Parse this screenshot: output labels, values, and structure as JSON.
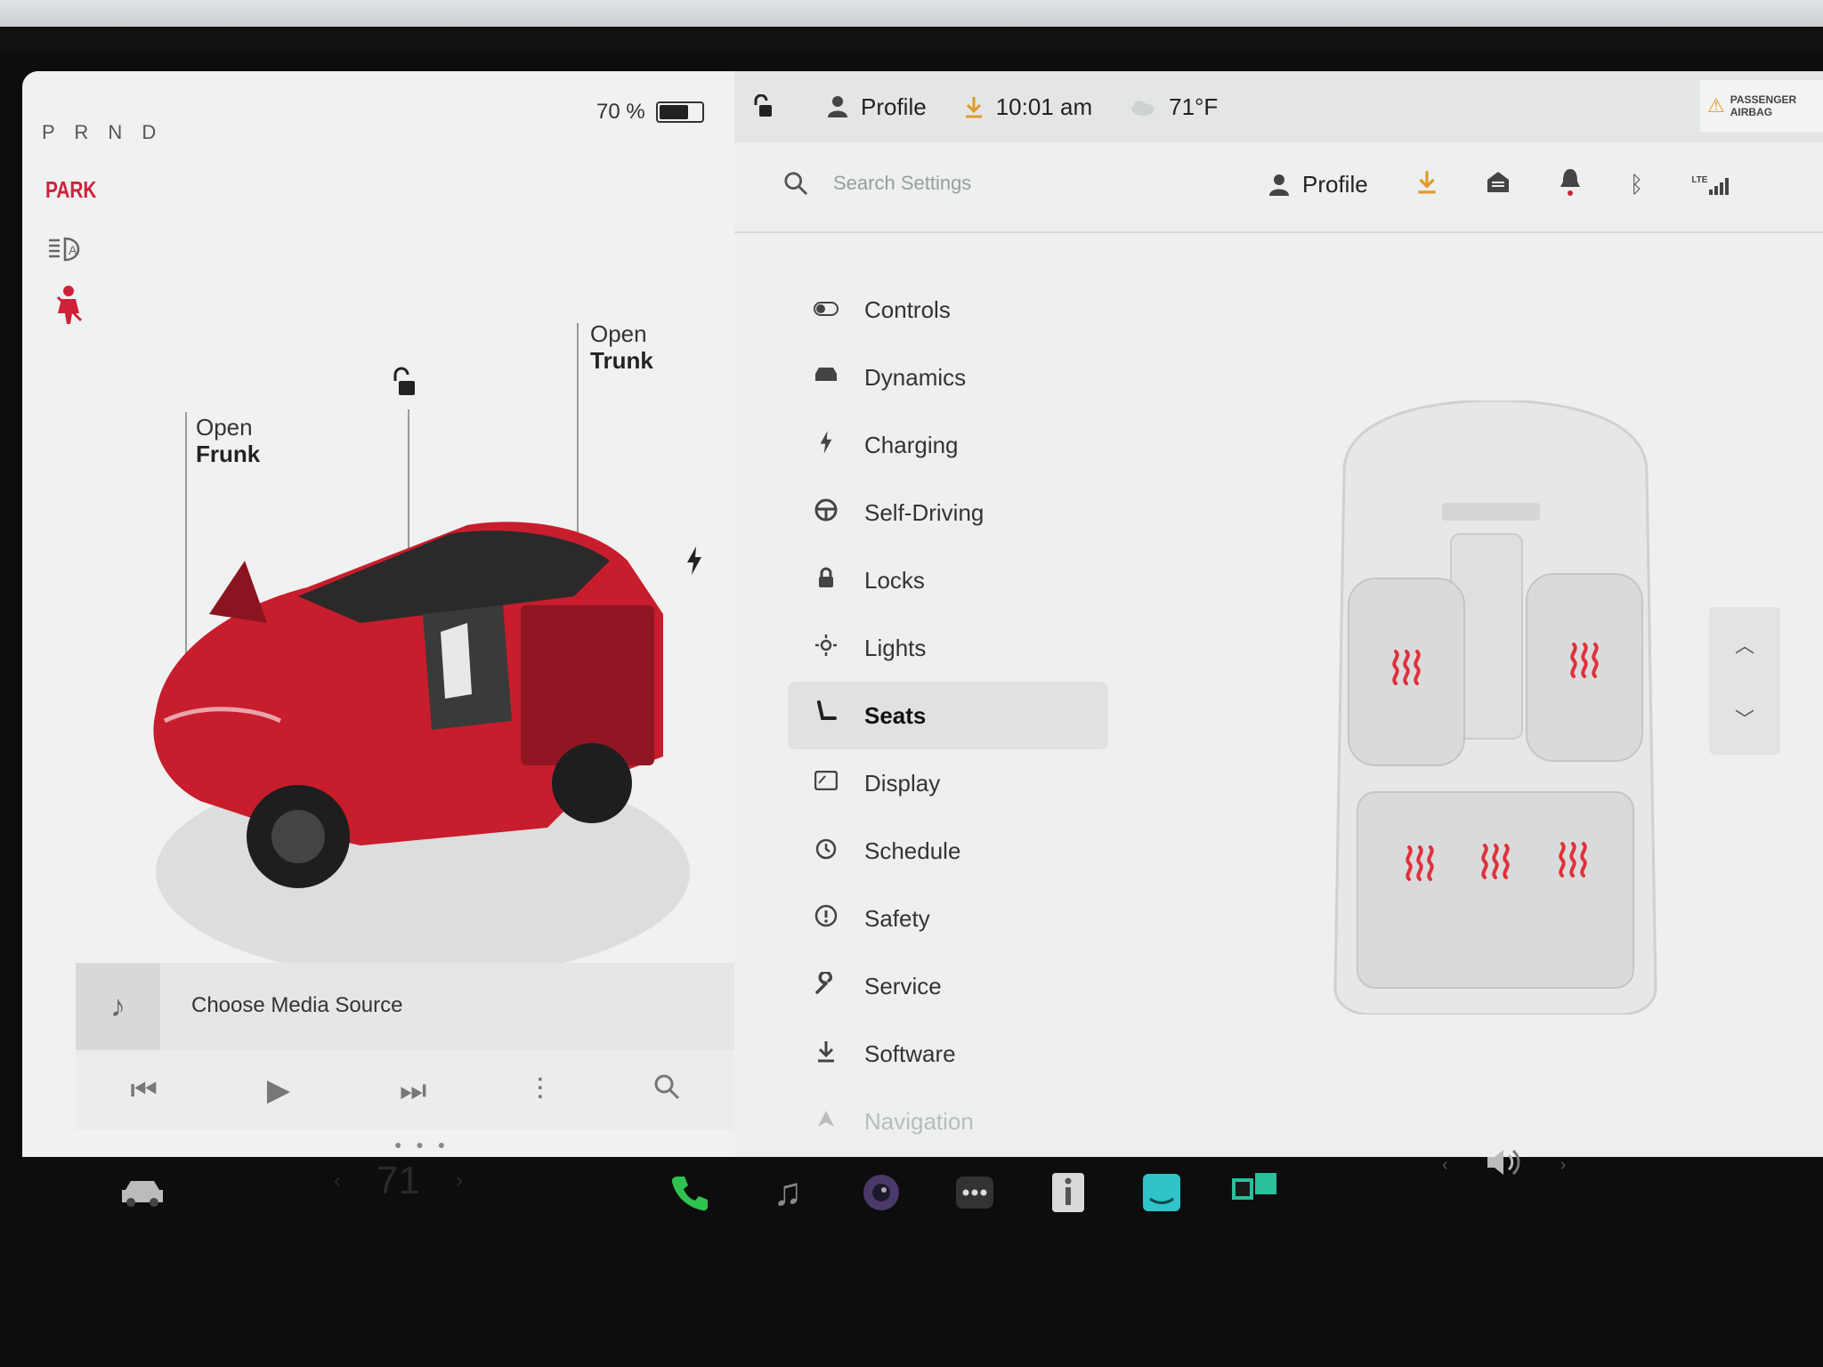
{
  "gear": {
    "prnd": "P R N D",
    "park": "PARK"
  },
  "battery": {
    "percent_label": "70 %",
    "level": 0.7
  },
  "car_labels": {
    "frunk_open": "Open",
    "frunk": "Frunk",
    "trunk_open": "Open",
    "trunk": "Trunk"
  },
  "media": {
    "source_label": "Choose Media Source"
  },
  "status": {
    "profile": "Profile",
    "time": "10:01 am",
    "temperature": "71°F",
    "airbag_line1": "PASSENGER",
    "airbag_line2": "AIRBAG"
  },
  "settings_header": {
    "search_placeholder": "Search Settings",
    "profile": "Profile",
    "lte": "LTE"
  },
  "menu": [
    {
      "label": "Controls",
      "icon": "toggle-icon"
    },
    {
      "label": "Dynamics",
      "icon": "car-icon"
    },
    {
      "label": "Charging",
      "icon": "bolt-icon"
    },
    {
      "label": "Self-Driving",
      "icon": "steering-wheel-icon"
    },
    {
      "label": "Locks",
      "icon": "lock-icon"
    },
    {
      "label": "Lights",
      "icon": "sun-icon"
    },
    {
      "label": "Seats",
      "icon": "seat-icon"
    },
    {
      "label": "Display",
      "icon": "display-icon"
    },
    {
      "label": "Schedule",
      "icon": "alarm-icon"
    },
    {
      "label": "Safety",
      "icon": "alert-icon"
    },
    {
      "label": "Service",
      "icon": "wrench-icon"
    },
    {
      "label": "Software",
      "icon": "download-icon"
    },
    {
      "label": "Navigation",
      "icon": "navigation-icon"
    }
  ],
  "active_menu": "Seats",
  "seat_heaters": {
    "front_left": "on",
    "front_right": "on",
    "rear_left": "on",
    "rear_center": "on",
    "rear_right": "on"
  },
  "taskbar": {
    "cabin_temp": "71"
  },
  "colors": {
    "accent_red": "#d0213a",
    "heater_red": "#e0303c",
    "phone_green": "#2fc24f",
    "music_teal": "#2ec4c9"
  }
}
